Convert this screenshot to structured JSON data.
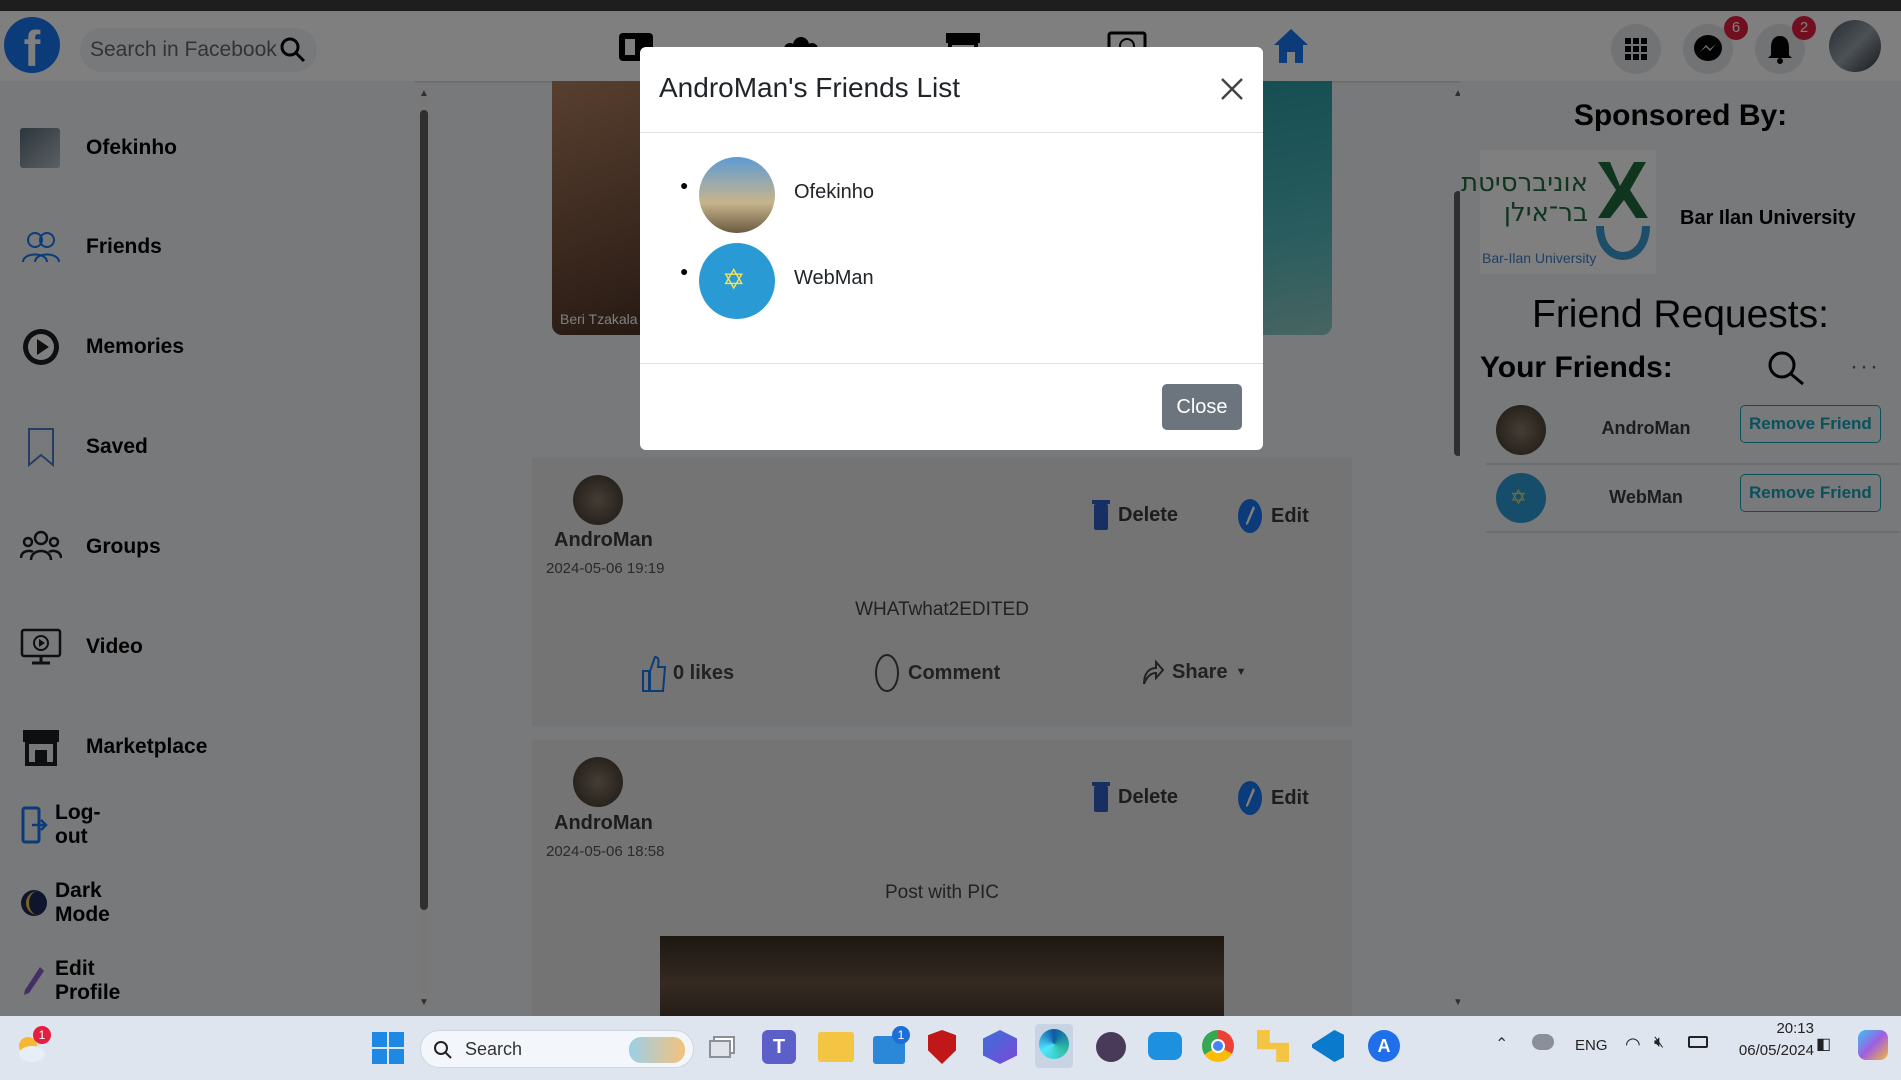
{
  "nav": {
    "search_placeholder": "Search in Facebook",
    "messenger_badge": "6",
    "notifications_badge": "2"
  },
  "sidebar": {
    "items": [
      {
        "label": "Ofekinho"
      },
      {
        "label": "Friends"
      },
      {
        "label": "Memories"
      },
      {
        "label": "Saved"
      },
      {
        "label": "Groups"
      },
      {
        "label": "Video"
      },
      {
        "label": "Marketplace"
      },
      {
        "label": "Log-out"
      },
      {
        "label": "Dark Mode"
      },
      {
        "label": "Edit Profile"
      }
    ]
  },
  "story": {
    "caption": "Beri Tzakala"
  },
  "posts": [
    {
      "author": "AndroMan",
      "date": "2024-05-06 19:19",
      "text": "WHATwhat2EDITED",
      "delete": "Delete",
      "edit": "Edit",
      "likes": "0 likes",
      "comment": "Comment",
      "share": "Share"
    },
    {
      "author": "AndroMan",
      "date": "2024-05-06 18:58",
      "text": "Post with PIC",
      "delete": "Delete",
      "edit": "Edit"
    }
  ],
  "right": {
    "sponsored_title": "Sponsored By:",
    "sponsor_name": "Bar Ilan University",
    "friend_requests_title": "Friend Requests:",
    "your_friends_title": "Your Friends:",
    "friends": [
      {
        "name": "AndroMan",
        "action": "Remove Friend"
      },
      {
        "name": "WebMan",
        "action": "Remove Friend"
      }
    ]
  },
  "modal": {
    "title": "AndroMan's Friends List",
    "friends": [
      {
        "name": "Ofekinho"
      },
      {
        "name": "WebMan"
      }
    ],
    "close_label": "Close"
  },
  "taskbar": {
    "search_label": "Search",
    "weather_badge": "1",
    "store_badge": "1",
    "lang": "ENG",
    "time": "20:13",
    "date": "06/05/2024"
  },
  "colors": {
    "brand": "#1877f2",
    "accent_teal": "#17a2b8",
    "close_button": "#6c757d"
  }
}
